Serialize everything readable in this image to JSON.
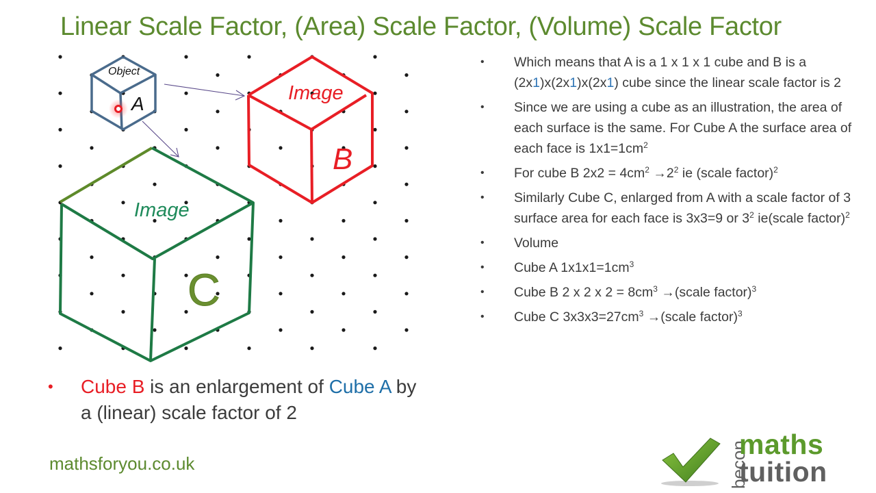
{
  "title": "Linear Scale Factor, (Area) Scale Factor, (Volume) Scale Factor",
  "colors": {
    "title_green": "#5c8a2f",
    "cube_a_blue": "#4a6b8c",
    "cube_b_red": "#e81e25",
    "cube_c_green": "#1e7a45",
    "cube_c_edge_olive": "#5e8a2a",
    "arrow_purple": "#5a4a8a",
    "dot_black": "#1a1a1a"
  },
  "diagram": {
    "cube_a": {
      "top_label": "Object",
      "side_label": "A",
      "edge_length_units": 1
    },
    "cube_b": {
      "top_label": "Image",
      "side_label": "B",
      "edge_length_units": 2
    },
    "cube_c": {
      "top_label": "Image",
      "side_label": "C",
      "edge_length_units": 3
    },
    "arrows": [
      {
        "from": "cube_a",
        "to": "cube_b"
      },
      {
        "from": "cube_a",
        "to": "cube_c"
      }
    ],
    "grid": "isometric dot grid"
  },
  "right_bullets": [
    {
      "segments": [
        {
          "text": "Which means that A is a 1 x 1 x 1 cube and B is a (2x"
        },
        {
          "text": "1",
          "color": "blue"
        },
        {
          "text": ")x(2x"
        },
        {
          "text": "1",
          "color": "blue"
        },
        {
          "text": ")x(2x"
        },
        {
          "text": "1",
          "color": "blue"
        },
        {
          "text": ") cube since the linear scale factor is 2"
        }
      ]
    },
    {
      "segments": [
        {
          "text": "Since we are using a cube as an illustration, the area of each surface is the same. For Cube A the surface area of each face is 1x1=1cm"
        },
        {
          "text": "2",
          "sup": true
        }
      ]
    },
    {
      "segments": [
        {
          "text": "For cube B 2x2 = 4cm"
        },
        {
          "text": "2",
          "sup": true
        },
        {
          "text": " →"
        },
        {
          "text": "2"
        },
        {
          "text": "2",
          "sup": true
        },
        {
          "text": "  ie (scale factor)"
        },
        {
          "text": "2",
          "sup": true
        }
      ]
    },
    {
      "segments": [
        {
          "text": "Similarly  Cube C, enlarged from A with a scale factor of 3 surface area for each face is 3x3=9  or 3"
        },
        {
          "text": "2",
          "sup": true
        },
        {
          "text": " ie(scale factor)"
        },
        {
          "text": "2",
          "sup": true
        }
      ]
    },
    {
      "segments": [
        {
          "text": "Volume"
        }
      ]
    },
    {
      "segments": [
        {
          "text": "Cube A  1x1x1=1cm"
        },
        {
          "text": "3",
          "sup": true
        }
      ]
    },
    {
      "segments": [
        {
          "text": "Cube B  2 x 2 x 2 = 8cm"
        },
        {
          "text": "3",
          "sup": true
        },
        {
          "text": " →(scale factor)"
        },
        {
          "text": "3",
          "sup": true
        }
      ]
    },
    {
      "segments": [
        {
          "text": "Cube C 3x3x3=27cm"
        },
        {
          "text": "3",
          "sup": true
        },
        {
          "text": " →(scale factor)"
        },
        {
          "text": "3",
          "sup": true
        }
      ]
    }
  ],
  "bullet_glyph": "•",
  "lower_bullet": {
    "part1": "Cube B",
    "part2": " is an enlargement of ",
    "part3": "Cube A",
    "part4": " by a (linear) scale factor of 2"
  },
  "website": "mathsforyou.co.uk",
  "logo": {
    "icon": "checkmark-icon",
    "prefix": "becon",
    "line1": "maths",
    "line2": "tuition"
  }
}
